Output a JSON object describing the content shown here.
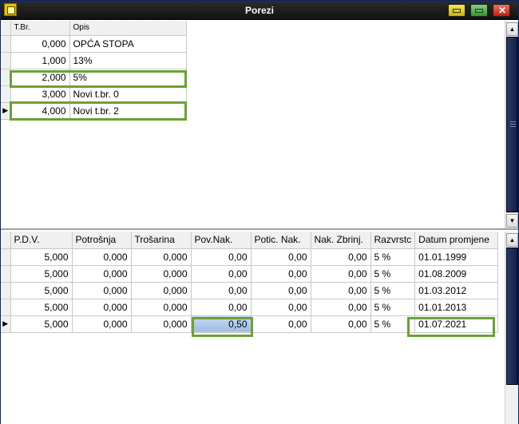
{
  "window": {
    "title": "Porezi"
  },
  "top_grid": {
    "columns": [
      "T.Br.",
      "Opis"
    ],
    "rows": [
      {
        "tbr": "0,000",
        "opis": "OPĆA STOPA"
      },
      {
        "tbr": "1,000",
        "opis": "13%"
      },
      {
        "tbr": "2,000",
        "opis": "5%"
      },
      {
        "tbr": "3,000",
        "opis": "Novi t.br. 0"
      },
      {
        "tbr": "4,000",
        "opis": "Novi t.br. 2"
      }
    ],
    "current_row_marker": "▶"
  },
  "bottom_grid": {
    "columns": [
      "P.D.V.",
      "Potrošnja",
      "Trošarina",
      "Pov.Nak.",
      "Potic. Nak.",
      "Nak. Zbrinj.",
      "Razvrstc",
      "Datum promjene"
    ],
    "rows": [
      {
        "pdv": "5,000",
        "potrosnja": "0,000",
        "trosarina": "0,000",
        "povnak": "0,00",
        "poticnak": "0,00",
        "nakzbrinj": "0,00",
        "razvrst": "5 %",
        "datum": "01.01.1999"
      },
      {
        "pdv": "5,000",
        "potrosnja": "0,000",
        "trosarina": "0,000",
        "povnak": "0,00",
        "poticnak": "0,00",
        "nakzbrinj": "0,00",
        "razvrst": "5 %",
        "datum": "01.08.2009"
      },
      {
        "pdv": "5,000",
        "potrosnja": "0,000",
        "trosarina": "0,000",
        "povnak": "0,00",
        "poticnak": "0,00",
        "nakzbrinj": "0,00",
        "razvrst": "5 %",
        "datum": "01.03.2012"
      },
      {
        "pdv": "5,000",
        "potrosnja": "0,000",
        "trosarina": "0,000",
        "povnak": "0,00",
        "poticnak": "0,00",
        "nakzbrinj": "0,00",
        "razvrst": "5 %",
        "datum": "01.01.2013"
      },
      {
        "pdv": "5,000",
        "potrosnja": "0,000",
        "trosarina": "0,000",
        "povnak": "0,50",
        "poticnak": "0,00",
        "nakzbrinj": "0,00",
        "razvrst": "5 %",
        "datum": "01.07.2021"
      }
    ],
    "current_row_marker": "▶"
  },
  "colors": {
    "highlight": "#6aa232",
    "selected_cell": "#a9c6e8",
    "scroll_thumb": "#1a2a55"
  }
}
